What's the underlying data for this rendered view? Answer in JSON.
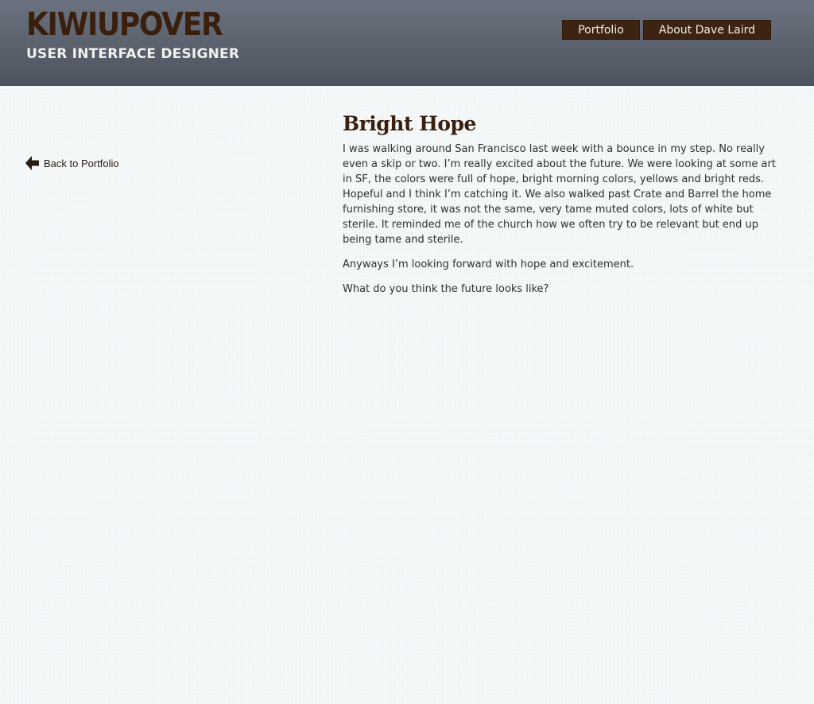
{
  "header": {
    "logo_title": "KIWIUPOVER",
    "logo_subtitle": "USER INTERFACE DESIGNER",
    "nav": [
      {
        "label": "Portfolio"
      },
      {
        "label": "About Dave Laird"
      }
    ]
  },
  "sidebar": {
    "back_icon": "back-arrow-icon",
    "back_label": "Back to Portfolio"
  },
  "article": {
    "title": "Bright Hope",
    "paragraphs": [
      "I was walking around San Francisco last week with a bounce in my step. No really even a skip or two. I’m really excited about the future. We were looking at some art in SF, the colors were full of hope, bright morning colors, yellows and bright reds. Hopeful and I think I’m catching it. We also walked past Crate and Barrel the home furnishing store, it was not the same, very tame muted colors, lots of white but sterile. It reminded me of the church how we often try to be relevant but end up being tame and sterile.",
      "Anyways I’m looking forward with hope and excitement.",
      "What do you think the future looks like?"
    ]
  },
  "colors": {
    "brand_brown": "#3b1f0d",
    "header_slate": "#5a616d",
    "page_background": "#f4f8f9"
  }
}
